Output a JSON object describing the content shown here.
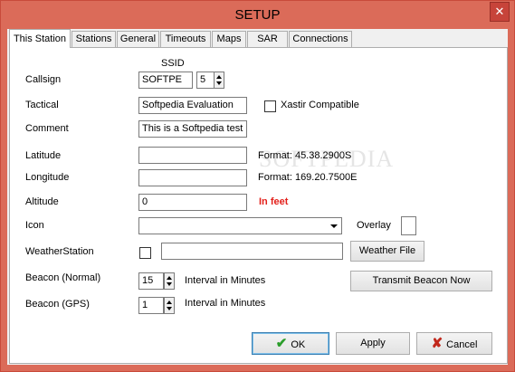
{
  "window": {
    "title": "SETUP",
    "close_icon": "close-icon"
  },
  "tabs": [
    {
      "label": "This Station",
      "active": true
    },
    {
      "label": "Stations"
    },
    {
      "label": "General"
    },
    {
      "label": "Timeouts"
    },
    {
      "label": "Maps"
    },
    {
      "label": "SAR"
    },
    {
      "label": "Connections"
    }
  ],
  "form": {
    "ssid_label": "SSID",
    "callsign_label": "Callsign",
    "callsign_value": "SOFTPE",
    "ssid_value": "5",
    "tactical_label": "Tactical",
    "tactical_value": "Softpedia Evaluation",
    "xastir_label": "Xastir Compatible",
    "comment_label": "Comment",
    "comment_value": "This is a Softpedia test",
    "latitude_label": "Latitude",
    "latitude_value": "",
    "latitude_format": "Format: 45.38.2900S",
    "longitude_label": "Longitude",
    "longitude_value": "",
    "longitude_format": "Format: 169.20.7500E",
    "altitude_label": "Altitude",
    "altitude_value": "0",
    "altitude_unit": "In feet",
    "icon_label": "Icon",
    "icon_value": "",
    "overlay_label": "Overlay",
    "overlay_value": "",
    "weather_label": "WeatherStation",
    "weather_value": "",
    "weather_file_button": "Weather File",
    "beacon_normal_label": "Beacon (Normal)",
    "beacon_normal_value": "15",
    "beacon_gps_label": "Beacon (GPS)",
    "beacon_gps_value": "1",
    "interval_label": "Interval in Minutes",
    "transmit_button": "Transmit Beacon Now"
  },
  "footer": {
    "ok": "OK",
    "apply": "Apply",
    "cancel": "Cancel"
  },
  "watermark": "SOFTPEDIA",
  "colors": {
    "title_bar": "#db6b59",
    "accent_red": "#e3201b"
  }
}
